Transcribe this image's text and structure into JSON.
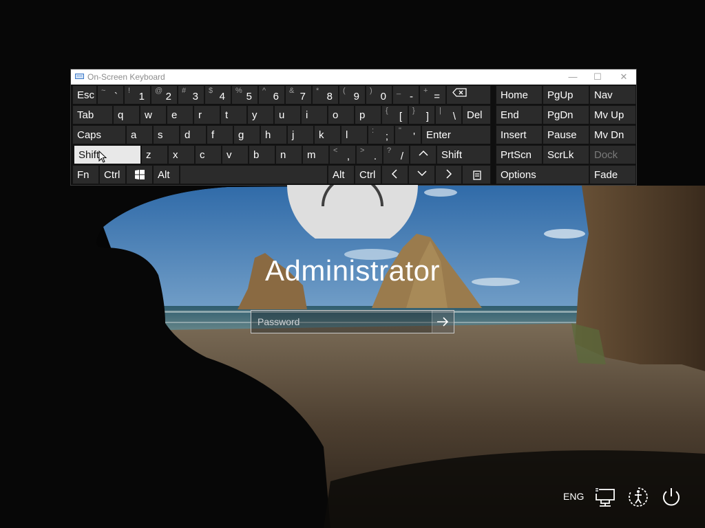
{
  "osk": {
    "title": "On-Screen Keyboard",
    "minimize": "—",
    "maximize": "☐",
    "close": "✕",
    "rows": [
      [
        {
          "name": "esc",
          "label": "Esc"
        },
        {
          "name": "tilde",
          "shifted": "~",
          "main": "`"
        },
        {
          "name": "1",
          "shifted": "!",
          "main": "1"
        },
        {
          "name": "2",
          "shifted": "@",
          "main": "2"
        },
        {
          "name": "3",
          "shifted": "#",
          "main": "3"
        },
        {
          "name": "4",
          "shifted": "$",
          "main": "4"
        },
        {
          "name": "5",
          "shifted": "%",
          "main": "5"
        },
        {
          "name": "6",
          "shifted": "^",
          "main": "6"
        },
        {
          "name": "7",
          "shifted": "&",
          "main": "7"
        },
        {
          "name": "8",
          "shifted": "*",
          "main": "8"
        },
        {
          "name": "9",
          "shifted": "(",
          "main": "9"
        },
        {
          "name": "0",
          "shifted": ")",
          "main": "0"
        },
        {
          "name": "minus",
          "shifted": "_",
          "main": "-"
        },
        {
          "name": "equals",
          "shifted": "+",
          "main": "="
        },
        {
          "name": "backspace",
          "label": "⌫"
        },
        {
          "name": "home",
          "label": "Home"
        },
        {
          "name": "pgup",
          "label": "PgUp"
        },
        {
          "name": "nav",
          "label": "Nav"
        }
      ],
      [
        {
          "name": "tab",
          "label": "Tab"
        },
        {
          "name": "q",
          "label": "q"
        },
        {
          "name": "w",
          "label": "w"
        },
        {
          "name": "e",
          "label": "e"
        },
        {
          "name": "r",
          "label": "r"
        },
        {
          "name": "t",
          "label": "t"
        },
        {
          "name": "y",
          "label": "y"
        },
        {
          "name": "u",
          "label": "u"
        },
        {
          "name": "i",
          "label": "i"
        },
        {
          "name": "o",
          "label": "o"
        },
        {
          "name": "p",
          "label": "p"
        },
        {
          "name": "lbracket",
          "shifted": "{",
          "main": "["
        },
        {
          "name": "rbracket",
          "shifted": "}",
          "main": "]"
        },
        {
          "name": "backslash",
          "shifted": "|",
          "main": "\\"
        },
        {
          "name": "del",
          "label": "Del"
        },
        {
          "name": "end",
          "label": "End"
        },
        {
          "name": "pgdn",
          "label": "PgDn"
        },
        {
          "name": "mvup",
          "label": "Mv Up"
        }
      ],
      [
        {
          "name": "caps",
          "label": "Caps"
        },
        {
          "name": "a",
          "label": "a"
        },
        {
          "name": "s",
          "label": "s"
        },
        {
          "name": "d",
          "label": "d"
        },
        {
          "name": "f",
          "label": "f"
        },
        {
          "name": "g",
          "label": "g"
        },
        {
          "name": "h",
          "label": "h"
        },
        {
          "name": "j",
          "label": "j"
        },
        {
          "name": "k",
          "label": "k"
        },
        {
          "name": "l",
          "label": "l"
        },
        {
          "name": "semicolon",
          "shifted": ":",
          "main": ";"
        },
        {
          "name": "quote",
          "shifted": "\"",
          "main": "'"
        },
        {
          "name": "enter",
          "label": "Enter"
        },
        {
          "name": "insert",
          "label": "Insert"
        },
        {
          "name": "pause",
          "label": "Pause"
        },
        {
          "name": "mvdn",
          "label": "Mv Dn"
        }
      ],
      [
        {
          "name": "lshift",
          "label": "Shift",
          "active": true
        },
        {
          "name": "z",
          "label": "z"
        },
        {
          "name": "x",
          "label": "x"
        },
        {
          "name": "c",
          "label": "c"
        },
        {
          "name": "v",
          "label": "v"
        },
        {
          "name": "b",
          "label": "b"
        },
        {
          "name": "n",
          "label": "n"
        },
        {
          "name": "m",
          "label": "m"
        },
        {
          "name": "comma",
          "shifted": "<",
          "main": ","
        },
        {
          "name": "period",
          "shifted": ">",
          "main": "."
        },
        {
          "name": "slash",
          "shifted": "?",
          "main": "/"
        },
        {
          "name": "up",
          "label": "^"
        },
        {
          "name": "rshift",
          "label": "Shift"
        },
        {
          "name": "prtscn",
          "label": "PrtScn"
        },
        {
          "name": "scrlk",
          "label": "ScrLk"
        },
        {
          "name": "dock",
          "label": "Dock",
          "dim": true
        }
      ],
      [
        {
          "name": "fn",
          "label": "Fn"
        },
        {
          "name": "lctrl",
          "label": "Ctrl"
        },
        {
          "name": "win",
          "label": "win"
        },
        {
          "name": "lalt",
          "label": "Alt"
        },
        {
          "name": "space",
          "label": ""
        },
        {
          "name": "ralt",
          "label": "Alt"
        },
        {
          "name": "rctrl",
          "label": "Ctrl"
        },
        {
          "name": "left",
          "label": "<"
        },
        {
          "name": "down",
          "label": "v"
        },
        {
          "name": "right",
          "label": ">"
        },
        {
          "name": "menu",
          "label": "menu"
        },
        {
          "name": "options",
          "label": "Options"
        },
        {
          "name": "fade",
          "label": "Fade"
        }
      ]
    ]
  },
  "login": {
    "username": "Administrator",
    "password_placeholder": "Password",
    "password_value": ""
  },
  "tray": {
    "language": "ENG",
    "icons": [
      "network-icon",
      "ease-of-access-icon",
      "power-icon"
    ]
  },
  "colors": {
    "key_bg": "#2b2b2b",
    "key_active": "#e8e8e8",
    "osk_bg": "#0f0f0f"
  }
}
